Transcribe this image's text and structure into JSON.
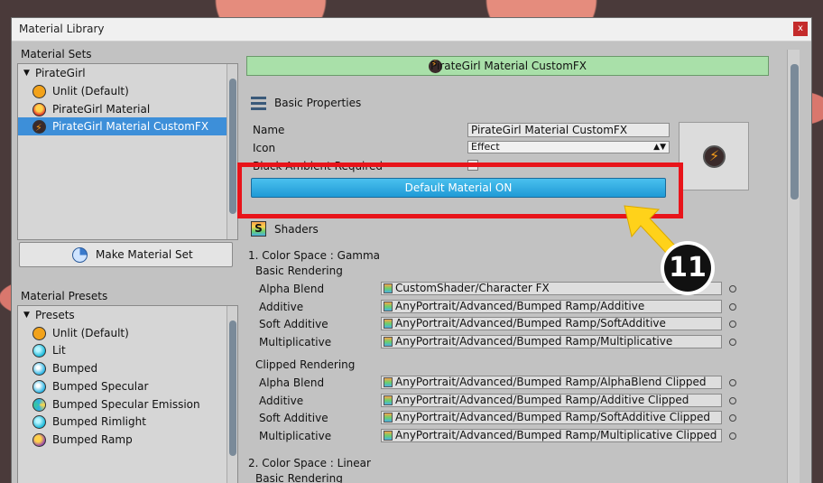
{
  "window": {
    "title": "Material Library",
    "close_label": "x"
  },
  "left": {
    "material_sets_label": "Material Sets",
    "sets": [
      {
        "label": "PirateGirl",
        "type": "group"
      },
      {
        "label": "Unlit (Default)",
        "icon": "unlit-material-icon"
      },
      {
        "label": "PirateGirl Material",
        "icon": "pirategirl-material-icon"
      },
      {
        "label": "PirateGirl Material CustomFX",
        "icon": "customfx-material-icon",
        "selected": true
      }
    ],
    "make_button": "Make Material Set",
    "presets_label": "Material Presets",
    "presets": [
      {
        "label": "Presets",
        "type": "group"
      },
      {
        "label": "Unlit (Default)",
        "icon": "unlit-preset-icon"
      },
      {
        "label": "Lit",
        "icon": "lit-preset-icon"
      },
      {
        "label": "Bumped",
        "icon": "bumped-preset-icon"
      },
      {
        "label": "Bumped Specular",
        "icon": "bumped-specular-preset-icon"
      },
      {
        "label": "Bumped Specular Emission",
        "icon": "bumped-specular-emission-preset-icon"
      },
      {
        "label": "Bumped Rimlight",
        "icon": "bumped-rimlight-preset-icon"
      },
      {
        "label": "Bumped Ramp",
        "icon": "bumped-ramp-preset-icon"
      }
    ]
  },
  "right": {
    "header": "PirateGirl Material CustomFX",
    "basic_properties": "Basic Properties",
    "name_label": "Name",
    "name_value": "PirateGirl Material CustomFX",
    "icon_label": "Icon",
    "icon_value": "Effect",
    "black_ambient_label": "Black Ambient Required",
    "default_button": "Default Material ON",
    "shaders_label": "Shaders",
    "color_space_1": "1. Color Space : Gamma",
    "basic_rendering": "Basic Rendering",
    "clipped_rendering": "Clipped Rendering",
    "color_space_2": "2. Color Space : Linear",
    "basic_rows": [
      {
        "label": "Alpha Blend",
        "value": "CustomShader/Character FX"
      },
      {
        "label": "Additive",
        "value": "AnyPortrait/Advanced/Bumped Ramp/Additive"
      },
      {
        "label": "Soft Additive",
        "value": "AnyPortrait/Advanced/Bumped Ramp/SoftAdditive"
      },
      {
        "label": "Multiplicative",
        "value": "AnyPortrait/Advanced/Bumped Ramp/Multiplicative"
      }
    ],
    "clipped_rows": [
      {
        "label": "Alpha Blend",
        "value": "AnyPortrait/Advanced/Bumped Ramp/AlphaBlend Clipped"
      },
      {
        "label": "Additive",
        "value": "AnyPortrait/Advanced/Bumped Ramp/Additive Clipped"
      },
      {
        "label": "Soft Additive",
        "value": "AnyPortrait/Advanced/Bumped Ramp/SoftAdditive Clipped"
      },
      {
        "label": "Multiplicative",
        "value": "AnyPortrait/Advanced/Bumped Ramp/Multiplicative Clipped"
      }
    ],
    "basic_rendering_2": "Basic Rendering"
  },
  "annotation": {
    "step_number": "11"
  },
  "colors": {
    "highlight": "#e8141a",
    "button_blue": "#2aa8e0",
    "header_green": "#a9e0a9",
    "arrow_yellow": "#ffd21a"
  }
}
